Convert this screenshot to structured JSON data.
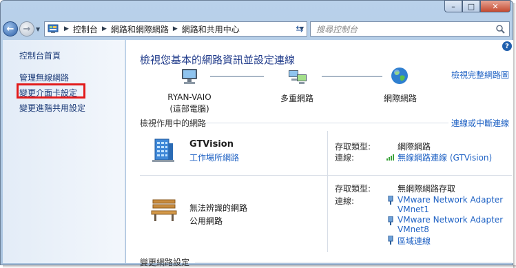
{
  "window": {
    "caption_minimize": "–",
    "caption_maximize": "□",
    "caption_close": "✕"
  },
  "address_bar": {
    "breadcrumbs": [
      "控制台",
      "網路和網際網路",
      "網路和共用中心"
    ],
    "search_placeholder": "搜尋控制台"
  },
  "sidebar": {
    "items": [
      {
        "label": "控制台首頁"
      },
      {
        "label": "管理無線網路"
      },
      {
        "label": "變更介面卡設定"
      },
      {
        "label": "變更進階共用設定"
      }
    ]
  },
  "main": {
    "title": "檢視您基本的網路資訊並設定連線",
    "view_full_map": "檢視完整網路圖",
    "map": {
      "computer_name": "RYAN-VAIO",
      "computer_sub": "(這部電腦)",
      "middle_label": "多重網路",
      "internet_label": "網際網路"
    },
    "active_networks_title": "檢視作用中的網路",
    "connect_disconnect": "連線或中斷連線",
    "networks": [
      {
        "name": "GTVision",
        "category": "工作場所網路",
        "access_type_key": "存取類型:",
        "access_type_value": "網際網路",
        "connections_key": "連線:",
        "connections": [
          "無線網路連線 (GTVision)"
        ]
      },
      {
        "name": "無法辨識的網路",
        "category": "公用網路",
        "access_type_key": "存取類型:",
        "access_type_value": "無網際網路存取",
        "connections_key": "連線:",
        "connections": [
          "VMware Network Adapter",
          "VMnet1",
          "VMware Network Adapter",
          "VMnet8",
          "區域連線"
        ]
      }
    ],
    "change_settings_title": "變更網路設定"
  },
  "colors": {
    "link": "#1f62c4",
    "title": "#1f3a8a",
    "highlight": "#e21a1a"
  }
}
